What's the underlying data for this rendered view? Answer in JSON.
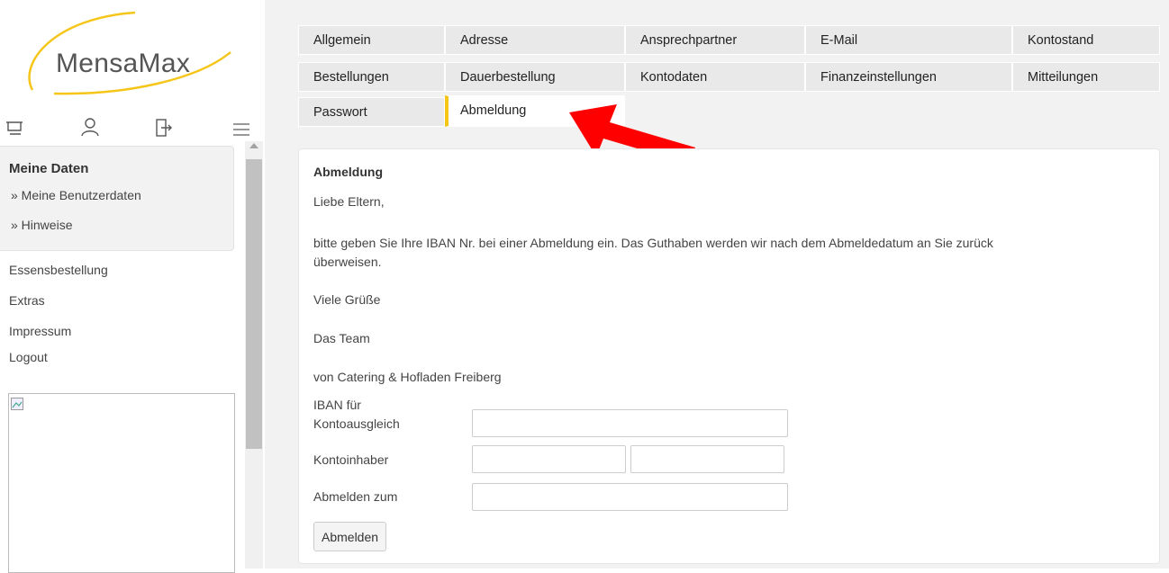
{
  "brand": {
    "logo_text": "MensaMax",
    "accent_color": "#f5c518"
  },
  "toolbar_icons": [
    "cart-icon",
    "user-icon",
    "logout-door-icon",
    "menu-icon"
  ],
  "sidebar": {
    "section_title": "Meine Daten",
    "sub_items": [
      "» Meine Benutzerdaten",
      "» Hinweise"
    ],
    "links": [
      "Essensbestellung",
      "Extras",
      "Impressum",
      "Logout"
    ]
  },
  "tabs": [
    [
      "Allgemein",
      "Adresse",
      "Ansprechpartner",
      "E-Mail",
      "Kontostand"
    ],
    [
      "Bestellungen",
      "Dauerbestellung",
      "Kontodaten",
      "Finanzeinstellungen",
      "Mitteilungen"
    ],
    [
      "Passwort",
      "Abmeldung"
    ]
  ],
  "active_tab": "Abmeldung",
  "content": {
    "heading": "Abmeldung",
    "greeting": "Liebe Eltern,",
    "message_line1": "bitte geben Sie Ihre IBAN Nr. bei einer Abmeldung ein. Das Guthaben werden wir nach dem Abmeldedatum an Sie zurück",
    "message_line2": "überweisen.",
    "regards": "Viele Grüße",
    "team": "Das Team",
    "signature": "von Catering & Hofladen Freiberg"
  },
  "form": {
    "iban_label_line1": "IBAN für",
    "iban_label_line2": "Kontoausgleich",
    "iban_value": "",
    "holder_label": "Kontoinhaber",
    "holder_first_value": "",
    "holder_last_value": "",
    "date_label": "Abmelden zum",
    "date_value": "",
    "submit_label": "Abmelden"
  },
  "annotation": {
    "arrow_color": "#ff0000",
    "points_to": "Abmeldung"
  }
}
